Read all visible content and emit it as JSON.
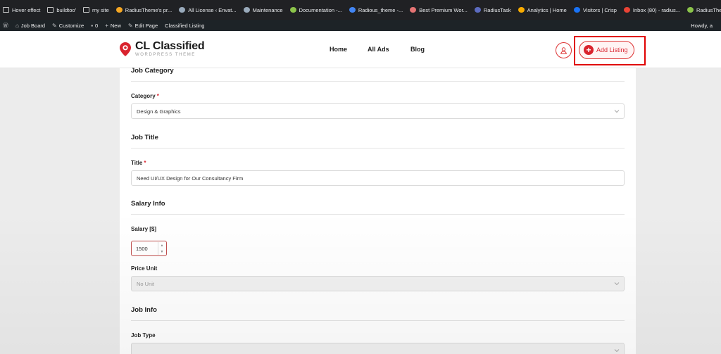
{
  "bookmarks": [
    {
      "label": "Hover effect",
      "icon": "folder-icon",
      "color": "#c7c7c7"
    },
    {
      "label": "buildtoo'",
      "icon": "folder-icon",
      "color": "#c7c7c7"
    },
    {
      "label": "my site",
      "icon": "folder-icon",
      "color": "#c7c7c7"
    },
    {
      "label": "RadiusTheme's pr...",
      "icon": "favicon-icon",
      "color": "#f5a623"
    },
    {
      "label": "All License ‹ Envat...",
      "icon": "wordpress-icon",
      "color": "#9ab"
    },
    {
      "label": "Maintenance",
      "icon": "wordpress-icon",
      "color": "#9ab"
    },
    {
      "label": "Documentation -...",
      "icon": "favicon-icon",
      "color": "#8bc34a"
    },
    {
      "label": "Radious_theme -...",
      "icon": "docs-icon",
      "color": "#4285f4"
    },
    {
      "label": "Best Premium Wor...",
      "icon": "favicon-icon",
      "color": "#e57373"
    },
    {
      "label": "RadiusTask",
      "icon": "favicon-icon",
      "color": "#5c6bc0"
    },
    {
      "label": "Analytics | Home",
      "icon": "analytics-icon",
      "color": "#f9ab00"
    },
    {
      "label": "Visitors | Crisp",
      "icon": "favicon-icon",
      "color": "#1972f5"
    },
    {
      "label": "Inbox (80) - radius...",
      "icon": "gmail-icon",
      "color": "#ea4335"
    },
    {
      "label": "RadiusTheme Enva...",
      "icon": "favicon-icon",
      "color": "#8bc34a"
    }
  ],
  "adminbar": {
    "site": "Job Board",
    "customize": "Customize",
    "comments": "0",
    "new": "New",
    "edit_page": "Edit Page",
    "plugin": "Classified Listing",
    "howdy": "Howdy, a"
  },
  "header": {
    "logo_title": "CL Classified",
    "logo_sub": "WORDPRESS THEME",
    "nav": [
      "Home",
      "All Ads",
      "Blog"
    ],
    "add_listing": "Add Listing",
    "brand_color": "#d9232e"
  },
  "form": {
    "job_category": {
      "section": "Job Category",
      "label": "Category",
      "value": "Design & Graphics"
    },
    "job_title": {
      "section": "Job Title",
      "label": "Title",
      "value": "Need UI/UX Design for Our Consultancy Firm"
    },
    "salary": {
      "section": "Salary Info",
      "label": "Salary [$]",
      "value": "1500",
      "price_unit_label": "Price Unit",
      "price_unit_value": "No Unit"
    },
    "job_info": {
      "section": "Job Info",
      "job_type_label": "Job Type"
    },
    "required_mark": "*"
  }
}
